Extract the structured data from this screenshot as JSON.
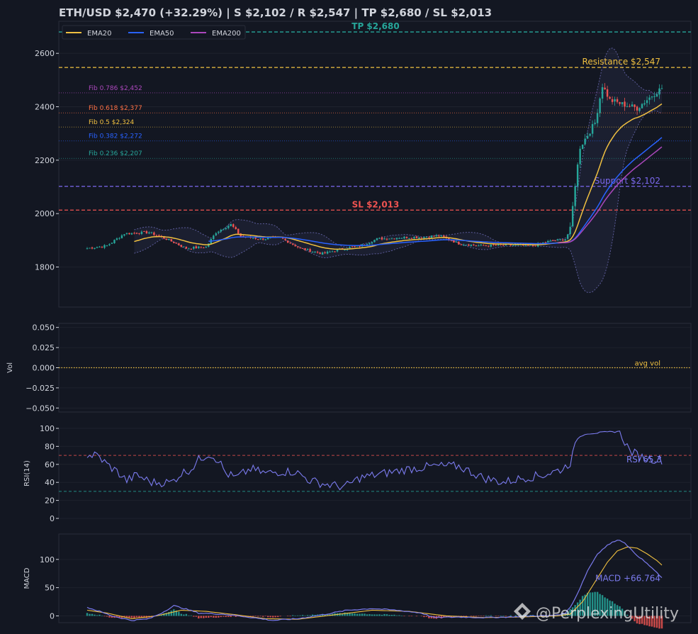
{
  "header": {
    "title": "ETH/USD   $2,470  (+32.29%)  |  S $2,102 / R $2,547  |  TP $2,680 / SL $2,013"
  },
  "watermark": {
    "text": "@PerplexingUtility",
    "icon": "binance-diamond-icon"
  },
  "colors": {
    "background": "#131722",
    "panel_border": "#2a2e39",
    "grid": "#1e222d",
    "text": "#d1d4dc",
    "up": "#26a69a",
    "down": "#ef5350",
    "ema20": "#f0c040",
    "ema50": "#2962ff",
    "ema200": "#ab47bc",
    "resistance": "#f0c040",
    "support": "#7b68ee",
    "tp": "#26a69a",
    "sl": "#ef5350",
    "bollinger": "#5c5c9a",
    "rsi": "#7b7bee",
    "macd": "#7b7bee",
    "signal": "#f0c040",
    "avg_vol": "#f0c040"
  },
  "chart_data": [
    {
      "type": "candlestick",
      "panel": "price",
      "ylim": [
        1650,
        2720
      ],
      "yticks": [
        1800,
        2000,
        2200,
        2400,
        2600
      ],
      "x_count": 215,
      "grid": true,
      "legend": {
        "placement": "top-left",
        "entries": [
          "EMA20",
          "EMA50",
          "EMA200"
        ]
      },
      "ema_start_index": {
        "EMA20": 19,
        "EMA50": 49,
        "EMA200": 190
      },
      "levels": [
        {
          "label": "TP $2,680",
          "value": 2680,
          "style": "dashed",
          "color_key": "tp",
          "label_pos": "center-above"
        },
        {
          "label": "Resistance $2,547",
          "value": 2547,
          "style": "dashed",
          "color_key": "resistance",
          "label_pos": "right-above"
        },
        {
          "label": "Support $2,102",
          "value": 2102,
          "style": "dashed",
          "color_key": "support",
          "label_pos": "right-above"
        },
        {
          "label": "SL $2,013",
          "value": 2013,
          "style": "dashed",
          "color_key": "sl",
          "label_pos": "center-above"
        }
      ],
      "fib_levels": [
        {
          "label": "Fib 0.786 $2,452",
          "value": 2452,
          "color": "#ab47bc"
        },
        {
          "label": "Fib 0.618 $2,377",
          "value": 2377,
          "color": "#ff7043"
        },
        {
          "label": "Fib 0.5 $2,324",
          "value": 2324,
          "color": "#f0c040"
        },
        {
          "label": "Fib 0.382 $2,272",
          "value": 2272,
          "color": "#2962ff"
        },
        {
          "label": "Fib 0.236 $2,207",
          "value": 2207,
          "color": "#26a69a"
        }
      ],
      "price_anchors": [
        [
          0,
          1870
        ],
        [
          8,
          1880
        ],
        [
          15,
          1925
        ],
        [
          25,
          1930
        ],
        [
          32,
          1905
        ],
        [
          40,
          1870
        ],
        [
          48,
          1875
        ],
        [
          52,
          1930
        ],
        [
          58,
          1960
        ],
        [
          62,
          1915
        ],
        [
          70,
          1905
        ],
        [
          78,
          1910
        ],
        [
          86,
          1870
        ],
        [
          95,
          1850
        ],
        [
          105,
          1872
        ],
        [
          110,
          1878
        ],
        [
          117,
          1905
        ],
        [
          125,
          1910
        ],
        [
          135,
          1912
        ],
        [
          142,
          1918
        ],
        [
          150,
          1888
        ],
        [
          158,
          1880
        ],
        [
          170,
          1882
        ],
        [
          180,
          1880
        ],
        [
          186,
          1895
        ],
        [
          193,
          1905
        ],
        [
          195,
          1940
        ],
        [
          197,
          2110
        ],
        [
          199,
          2250
        ],
        [
          205,
          2340
        ],
        [
          208,
          2480
        ],
        [
          211,
          2425
        ],
        [
          216,
          2410
        ],
        [
          222,
          2395
        ],
        [
          229,
          2450
        ],
        [
          232,
          2470
        ]
      ]
    },
    {
      "type": "bar",
      "panel": "volume",
      "ylabel": "Vol",
      "ylim": [
        -0.055,
        0.055
      ],
      "yticks": [
        "0.050",
        "0.025",
        "0.000",
        "−0.025",
        "−0.050"
      ],
      "yticks_values": [
        0.05,
        0.025,
        0,
        -0.025,
        -0.05
      ],
      "avg_line": {
        "label": "avg vol",
        "value": 0
      },
      "values": []
    },
    {
      "type": "line",
      "panel": "rsi",
      "ylabel": "RSI(14)",
      "ylim": [
        0,
        100
      ],
      "yticks": [
        0,
        20,
        40,
        60,
        80,
        100
      ],
      "overbought": 70,
      "oversold": 30,
      "latest_label": "RSI 65.3",
      "anchors": [
        [
          0,
          70
        ],
        [
          4,
          70
        ],
        [
          8,
          60
        ],
        [
          12,
          52
        ],
        [
          16,
          42
        ],
        [
          20,
          48
        ],
        [
          26,
          40
        ],
        [
          34,
          40
        ],
        [
          38,
          50
        ],
        [
          42,
          55
        ],
        [
          45,
          65
        ],
        [
          49,
          72
        ],
        [
          53,
          65
        ],
        [
          56,
          50
        ],
        [
          60,
          45
        ],
        [
          66,
          55
        ],
        [
          72,
          50
        ],
        [
          78,
          52
        ],
        [
          84,
          52
        ],
        [
          90,
          42
        ],
        [
          96,
          38
        ],
        [
          104,
          35
        ],
        [
          110,
          45
        ],
        [
          120,
          50
        ],
        [
          130,
          55
        ],
        [
          140,
          58
        ],
        [
          150,
          58
        ],
        [
          160,
          45
        ],
        [
          168,
          40
        ],
        [
          176,
          45
        ],
        [
          184,
          48
        ],
        [
          192,
          55
        ],
        [
          195,
          62
        ],
        [
          198,
          88
        ],
        [
          201,
          93
        ],
        [
          206,
          94
        ],
        [
          212,
          95
        ],
        [
          215,
          96
        ],
        [
          219,
          75
        ],
        [
          224,
          68
        ],
        [
          228,
          66
        ],
        [
          232,
          65
        ]
      ]
    },
    {
      "type": "line",
      "panel": "macd",
      "ylabel": "MACD",
      "ylim": [
        -12,
        145
      ],
      "yticks": [
        0,
        50,
        100
      ],
      "latest_label": "MACD +66.764",
      "macd_anchors": [
        [
          0,
          15
        ],
        [
          5,
          8
        ],
        [
          10,
          0
        ],
        [
          18,
          -8
        ],
        [
          25,
          -5
        ],
        [
          30,
          5
        ],
        [
          35,
          18
        ],
        [
          40,
          12
        ],
        [
          45,
          5
        ],
        [
          55,
          3
        ],
        [
          65,
          -2
        ],
        [
          75,
          -8
        ],
        [
          85,
          -5
        ],
        [
          95,
          2
        ],
        [
          105,
          10
        ],
        [
          115,
          13
        ],
        [
          125,
          10
        ],
        [
          135,
          5
        ],
        [
          140,
          -3
        ],
        [
          150,
          -2
        ],
        [
          160,
          -3
        ],
        [
          170,
          -2
        ],
        [
          180,
          0
        ],
        [
          186,
          0
        ],
        [
          190,
          2
        ],
        [
          193,
          5
        ],
        [
          195,
          15
        ],
        [
          198,
          40
        ],
        [
          202,
          80
        ],
        [
          206,
          110
        ],
        [
          210,
          125
        ],
        [
          214,
          135
        ],
        [
          217,
          130
        ],
        [
          220,
          115
        ],
        [
          224,
          100
        ],
        [
          228,
          85
        ],
        [
          232,
          67
        ]
      ],
      "signal_anchors": [
        [
          0,
          10
        ],
        [
          8,
          5
        ],
        [
          18,
          -5
        ],
        [
          28,
          0
        ],
        [
          38,
          10
        ],
        [
          48,
          8
        ],
        [
          60,
          2
        ],
        [
          72,
          -5
        ],
        [
          85,
          -6
        ],
        [
          100,
          2
        ],
        [
          115,
          10
        ],
        [
          130,
          8
        ],
        [
          145,
          0
        ],
        [
          160,
          -3
        ],
        [
          175,
          -2
        ],
        [
          190,
          0
        ],
        [
          195,
          3
        ],
        [
          200,
          25
        ],
        [
          205,
          60
        ],
        [
          210,
          95
        ],
        [
          214,
          115
        ],
        [
          218,
          122
        ],
        [
          222,
          120
        ],
        [
          226,
          110
        ],
        [
          230,
          98
        ],
        [
          232,
          90
        ]
      ]
    }
  ]
}
